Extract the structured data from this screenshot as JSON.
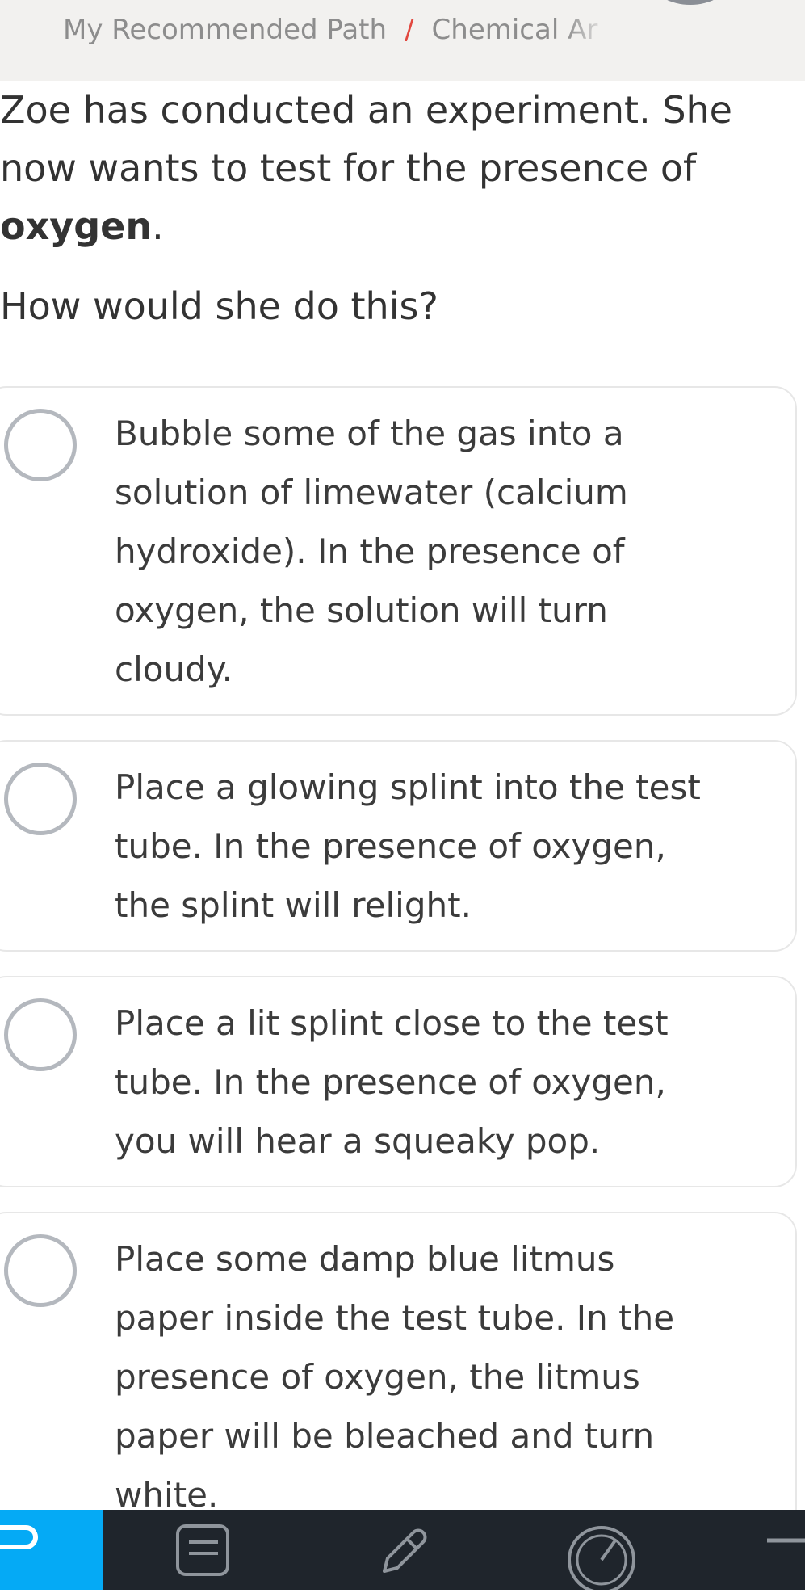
{
  "header": {
    "breadcrumb_path": "My Recommended Path",
    "breadcrumb_separator": "/",
    "breadcrumb_current": "Chemical Ar"
  },
  "question": {
    "line1": "Zoe has conducted an experiment. She",
    "line2": "now wants to test for the presence of",
    "bold_word": "oxygen",
    "end_punct": ".",
    "prompt": "How would she do this?"
  },
  "options": [
    {
      "lines": [
        "Bubble some of the gas into a",
        "solution of limewater (calcium",
        "hydroxide). In the presence of",
        "oxygen, the solution will turn",
        "cloudy."
      ],
      "selected": false
    },
    {
      "lines": [
        "Place a glowing splint into the test",
        "tube. In the presence of oxygen,",
        "the splint will relight."
      ],
      "selected": false
    },
    {
      "lines": [
        "Place a lit splint close to the test",
        "tube. In the presence of oxygen,",
        "you will hear a squeaky pop."
      ],
      "selected": false
    },
    {
      "lines": [
        "Place some damp blue litmus",
        "paper inside the test tube. In the",
        "presence of oxygen, the litmus",
        "paper will be bleached and turn",
        "white."
      ],
      "selected": false
    }
  ],
  "bottom_nav": {
    "items": [
      {
        "icon": "path-icon",
        "active": true
      },
      {
        "icon": "list-icon",
        "active": false
      },
      {
        "icon": "pencil-icon",
        "active": false
      },
      {
        "icon": "gauge-icon",
        "active": false
      },
      {
        "icon": "menu-icon",
        "active": false
      }
    ]
  },
  "colors": {
    "accent": "#05aaf5",
    "separator": "#e2483f",
    "nav_bg": "#1f252c",
    "radio_border": "#b4b8be"
  }
}
